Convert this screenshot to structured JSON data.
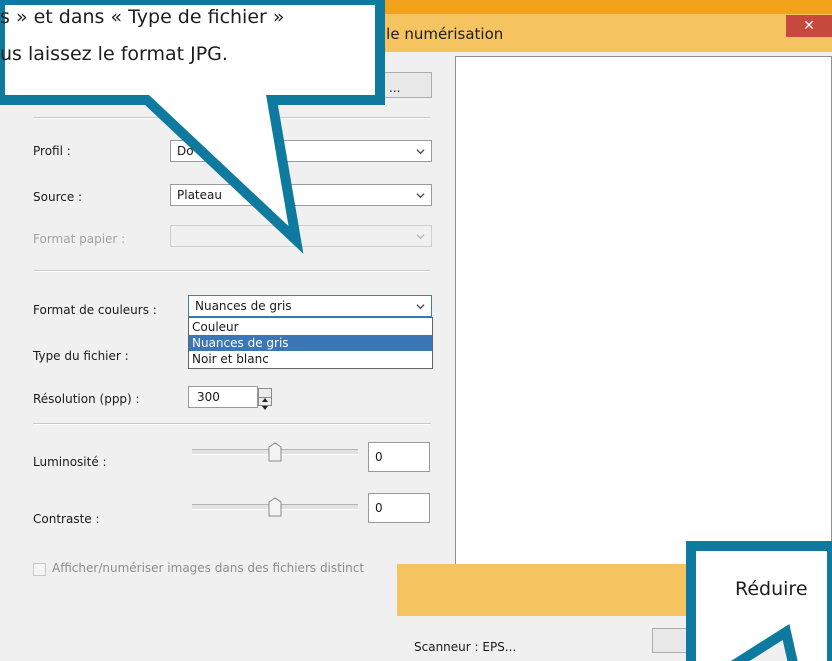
{
  "window": {
    "title": "lle numérisation",
    "close_glyph": "✕"
  },
  "profile_button": {
    "label": "..."
  },
  "form": {
    "profile": {
      "label": "Profil :",
      "value": "Do"
    },
    "source": {
      "label": "Source :",
      "value": "Plateau"
    },
    "paper_format": {
      "label": "Format papier :",
      "value": ""
    },
    "color_format": {
      "label": "Format de couleurs :",
      "value": "Nuances de gris",
      "options": [
        "Couleur",
        "Nuances de gris",
        "Noir et blanc"
      ],
      "selected_option": "Nuances de gris"
    },
    "file_type": {
      "label": "Type du fichier :"
    },
    "resolution": {
      "label": "Résolution (ppp) :",
      "value": "300"
    },
    "brightness": {
      "label": "Luminosité :",
      "value": "0",
      "level": 0.5
    },
    "contrast": {
      "label": "Contraste :",
      "value": "0",
      "level": 0.5
    },
    "separate_files": {
      "label": "Afficher/numériser images dans des fichiers distinct",
      "checked": false
    }
  },
  "scanner": {
    "label": "Scanneur : EPS..."
  },
  "callout_top": {
    "line1": "s » et dans « Type de fichier »",
    "line2": "us laissez le format JPG."
  },
  "callout_bottom": {
    "text": "Réduire"
  },
  "icons": {
    "chevron": "chevron-down-icon",
    "spin_up": "arrow-up-icon",
    "spin_down": "arrow-down-icon",
    "slider_thumb": "slider-thumb-icon"
  },
  "colors": {
    "desktop": "#f3a21b",
    "titlebar": "#f5c35f",
    "close": "#c7483d",
    "callout_border": "#0f7aa0",
    "selection": "#3b76b8"
  }
}
